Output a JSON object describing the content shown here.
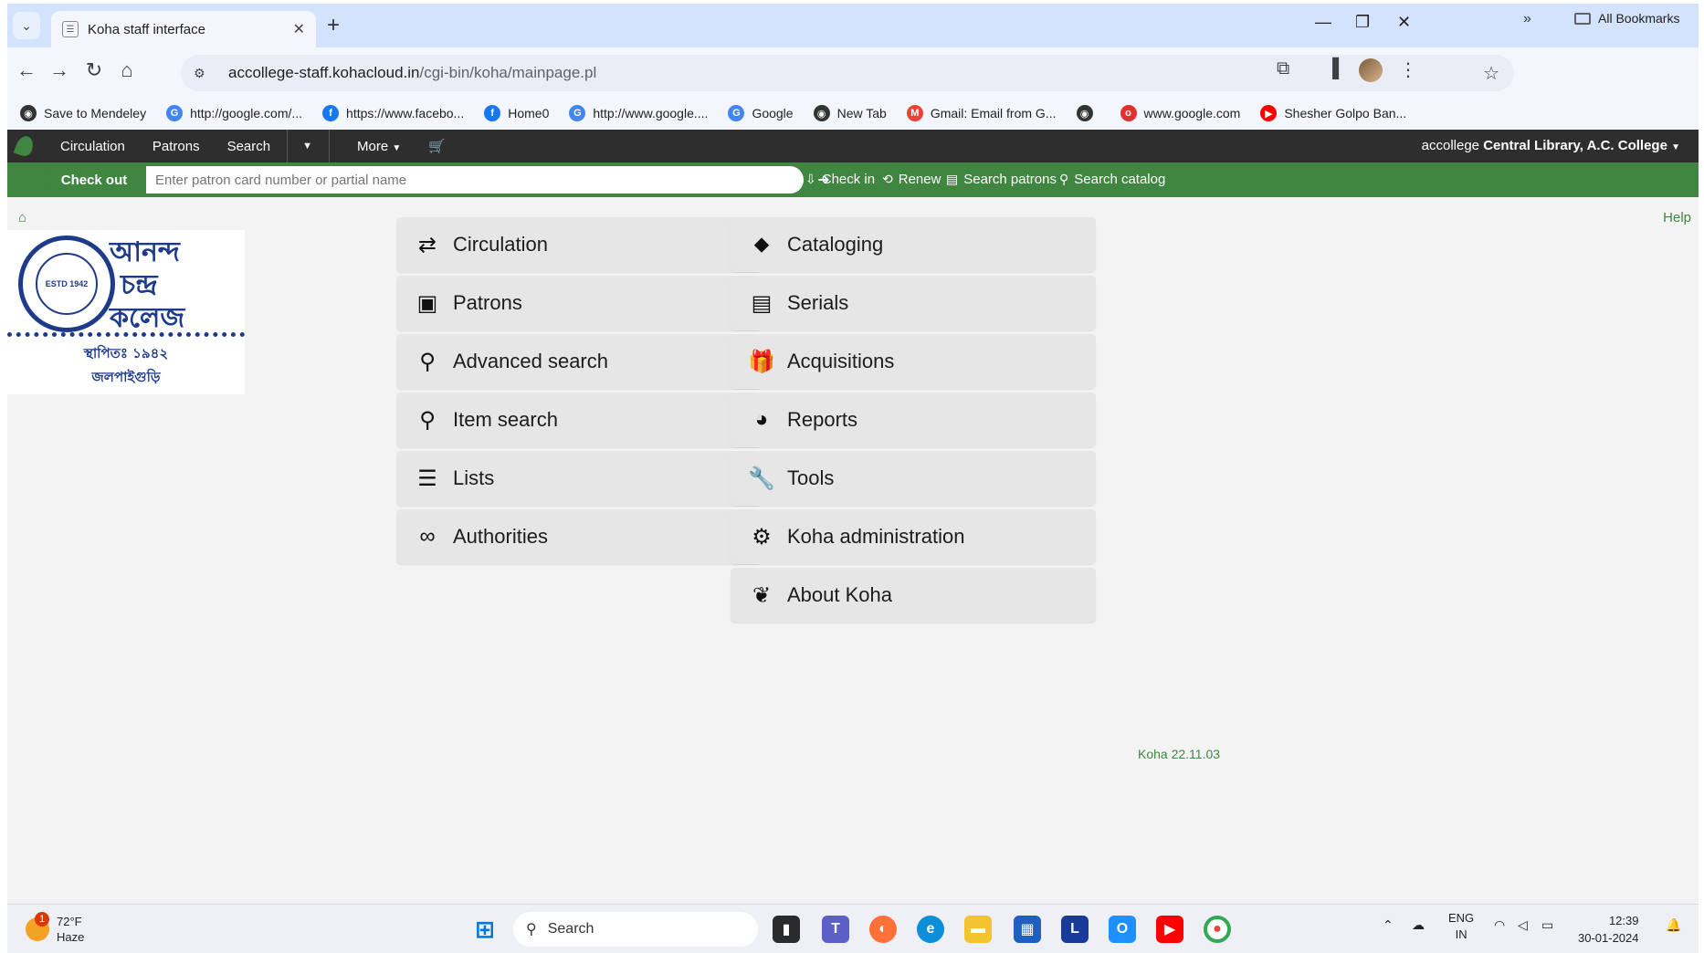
{
  "browser": {
    "tab_title": "Koha staff interface",
    "url_host": "accollege-staff.kohacloud.in",
    "url_path": "/cgi-bin/koha/mainpage.pl",
    "bookmarks": [
      {
        "label": "Save to Mendeley",
        "icon": "mendeley-icon",
        "color": "#333333",
        "glyph": "◉"
      },
      {
        "label": "http://google.com/...",
        "icon": "google-icon",
        "color": "#4285f4",
        "glyph": "G"
      },
      {
        "label": "https://www.facebo...",
        "icon": "facebook-icon",
        "color": "#1877f2",
        "glyph": "f"
      },
      {
        "label": "Home0",
        "icon": "facebook-icon",
        "color": "#1877f2",
        "glyph": "f"
      },
      {
        "label": "http://www.google....",
        "icon": "google-icon",
        "color": "#4285f4",
        "glyph": "G"
      },
      {
        "label": "Google",
        "icon": "google-icon",
        "color": "#4285f4",
        "glyph": "G"
      },
      {
        "label": "New Tab",
        "icon": "globe-icon",
        "color": "#333333",
        "glyph": "◉"
      },
      {
        "label": "Gmail: Email from G...",
        "icon": "gmail-icon",
        "color": "#ea4335",
        "glyph": "M"
      },
      {
        "label": "",
        "icon": "globe-icon",
        "color": "#333333",
        "glyph": "◉"
      },
      {
        "label": "www.google.com",
        "icon": "opera-icon",
        "color": "#e0312e",
        "glyph": "o"
      },
      {
        "label": "Shesher Golpo Ban...",
        "icon": "youtube-icon",
        "color": "#ff0000",
        "glyph": "▶"
      }
    ],
    "all_bookmarks_label": "All Bookmarks"
  },
  "koha_nav": {
    "items": [
      "Circulation",
      "Patrons",
      "Search"
    ],
    "more_label": "More",
    "user": "accollege",
    "library": "Central Library, A.C. College"
  },
  "checkout_bar": {
    "label": "Check out",
    "placeholder": "Enter patron card number or partial name",
    "links": [
      {
        "label": "Check out",
        "icon": "upload-icon",
        "glyph": "⇪",
        "active": true
      },
      {
        "label": "Check in",
        "icon": "download-icon",
        "glyph": "⇩",
        "active": false
      },
      {
        "label": "Renew",
        "icon": "renew-icon",
        "glyph": "⟲",
        "active": false
      },
      {
        "label": "Search patrons",
        "icon": "id-card-icon",
        "glyph": "▤",
        "active": false
      },
      {
        "label": "Search catalog",
        "icon": "search-icon",
        "glyph": "⚲",
        "active": false
      }
    ]
  },
  "content": {
    "help_label": "Help",
    "logo": {
      "line1": "আনন্দ",
      "line2": "চন্দ্র",
      "line3": "কলেজ",
      "seal_text": "ESTD 1942",
      "line4": "স্থাপিতঃ ১৯৪২",
      "line5": "জলপাইগুড়ি"
    },
    "left_tiles": [
      {
        "label": "Circulation",
        "icon": "arrows-exchange-icon",
        "glyph": "⇄"
      },
      {
        "label": "Patrons",
        "icon": "id-card-icon",
        "glyph": "▣"
      },
      {
        "label": "Advanced search",
        "icon": "search-icon",
        "glyph": "⚲"
      },
      {
        "label": "Item search",
        "icon": "search-icon",
        "glyph": "⚲"
      },
      {
        "label": "Lists",
        "icon": "list-icon",
        "glyph": "☰"
      },
      {
        "label": "Authorities",
        "icon": "link-icon",
        "glyph": "∞"
      }
    ],
    "right_tiles": [
      {
        "label": "Cataloging",
        "icon": "tag-icon",
        "glyph": "⬥"
      },
      {
        "label": "Serials",
        "icon": "newspaper-icon",
        "glyph": "▤"
      },
      {
        "label": "Acquisitions",
        "icon": "gift-icon",
        "glyph": "🎁"
      },
      {
        "label": "Reports",
        "icon": "pie-chart-icon",
        "glyph": "◕"
      },
      {
        "label": "Tools",
        "icon": "wrench-icon",
        "glyph": "🔧"
      },
      {
        "label": "Koha administration",
        "icon": "gears-icon",
        "glyph": "⚙"
      },
      {
        "label": "About Koha",
        "icon": "koha-leaf-icon",
        "glyph": "❦"
      }
    ],
    "version": "Koha 22.11.03"
  },
  "taskbar": {
    "weather_temp": "72°F",
    "weather_desc": "Haze",
    "weather_badge": "1",
    "search_label": "Search",
    "lang1": "ENG",
    "lang2": "IN",
    "time": "12:39",
    "date": "30-01-2024"
  },
  "colors": {
    "koha_green": "#408540",
    "nav_dark": "#2e2e2e",
    "tile_bg": "#e6e6e6"
  }
}
